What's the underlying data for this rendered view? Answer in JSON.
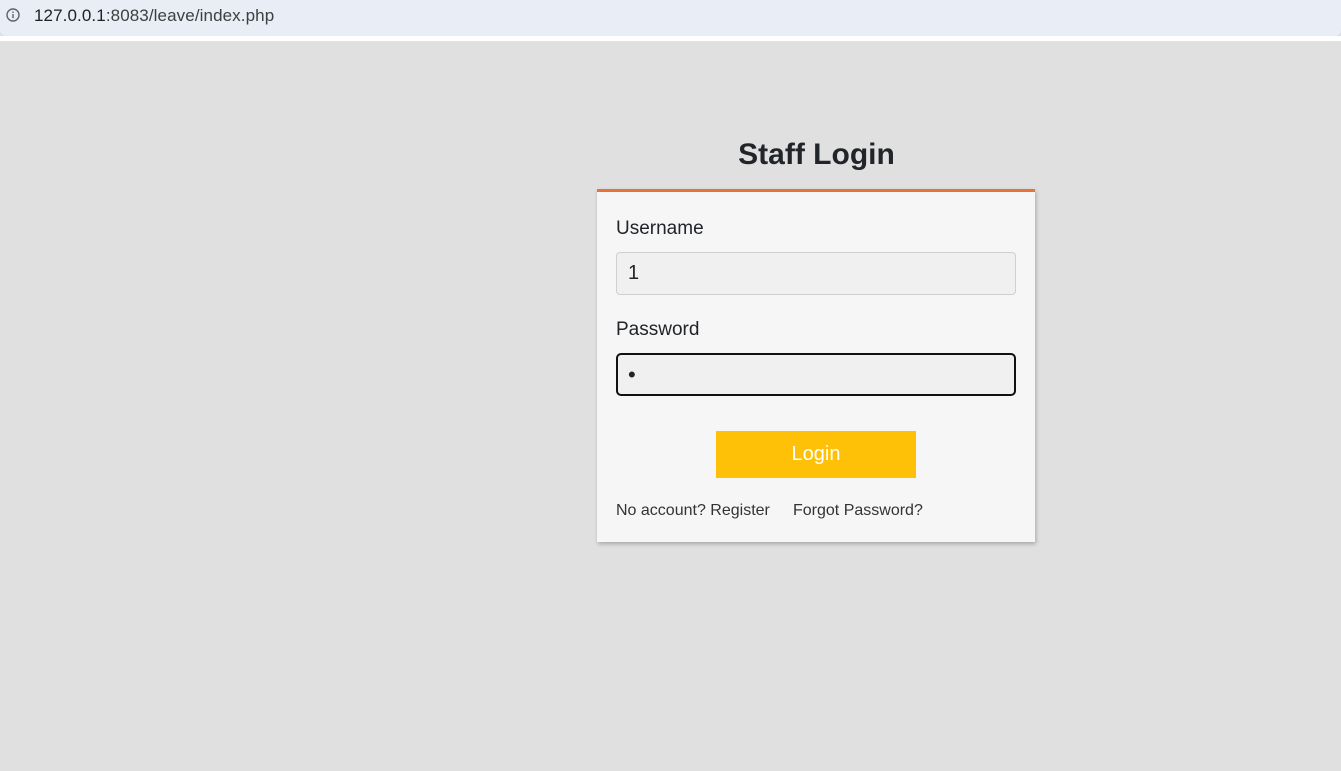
{
  "browser": {
    "url_host": "127.0.0.1",
    "url_rest": ":8083/leave/index.php",
    "info_icon": "info-circle-icon"
  },
  "login": {
    "title": "Staff Login",
    "username_label": "Username",
    "username_value": "1",
    "password_label": "Password",
    "password_value": "•",
    "button_label": "Login",
    "register_link": "No account? Register",
    "forgot_link": "Forgot Password?"
  },
  "colors": {
    "background": "#e0e0e0",
    "card": "#f7f6f6",
    "card_top_border": "#e8733a",
    "button": "#ffc107",
    "button_text": "#ffffff"
  }
}
